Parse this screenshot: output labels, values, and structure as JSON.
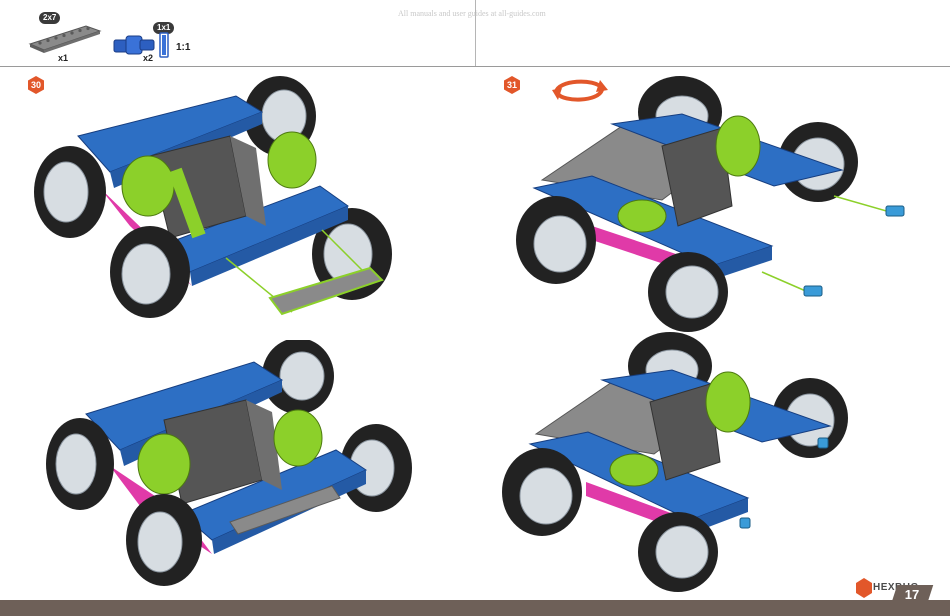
{
  "watermark": "All manuals and user guides at all-guides.com",
  "parts": [
    {
      "tag": "2x7",
      "qty": "x1"
    },
    {
      "tag": "1x1",
      "qty": "x2",
      "ratio": "1:1"
    }
  ],
  "steps": [
    {
      "number": "30"
    },
    {
      "number": "31"
    }
  ],
  "brand": {
    "name": "HEXBUG"
  },
  "page": {
    "number": "17"
  },
  "colors": {
    "accent": "#e2572a",
    "frame": "#2d6fc4",
    "green": "#8cd02a",
    "pink": "#e03aa8",
    "tire": "#222222",
    "grey": "#6b6b6b"
  }
}
